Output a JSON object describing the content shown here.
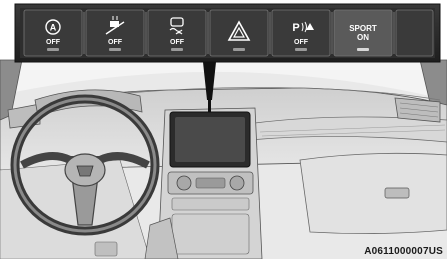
{
  "switch_bank": {
    "switches": [
      {
        "icon": "auto-stop-start-icon",
        "glyph": "A",
        "state": "OFF",
        "active": false
      },
      {
        "icon": "hill-descent-icon",
        "glyph": "",
        "state": "OFF",
        "active": false
      },
      {
        "icon": "traction-control-icon",
        "glyph": "",
        "state": "OFF",
        "active": false
      },
      {
        "icon": "hazard-warning-icon",
        "glyph": "",
        "state": "",
        "active": false
      },
      {
        "icon": "park-assist-icon",
        "glyph": "P",
        "state": "OFF",
        "active": false
      },
      {
        "icon": "sport-mode-icon",
        "mode": "SPORT",
        "state": "ON",
        "active": true
      }
    ]
  },
  "figure_code": "A0611000007US"
}
